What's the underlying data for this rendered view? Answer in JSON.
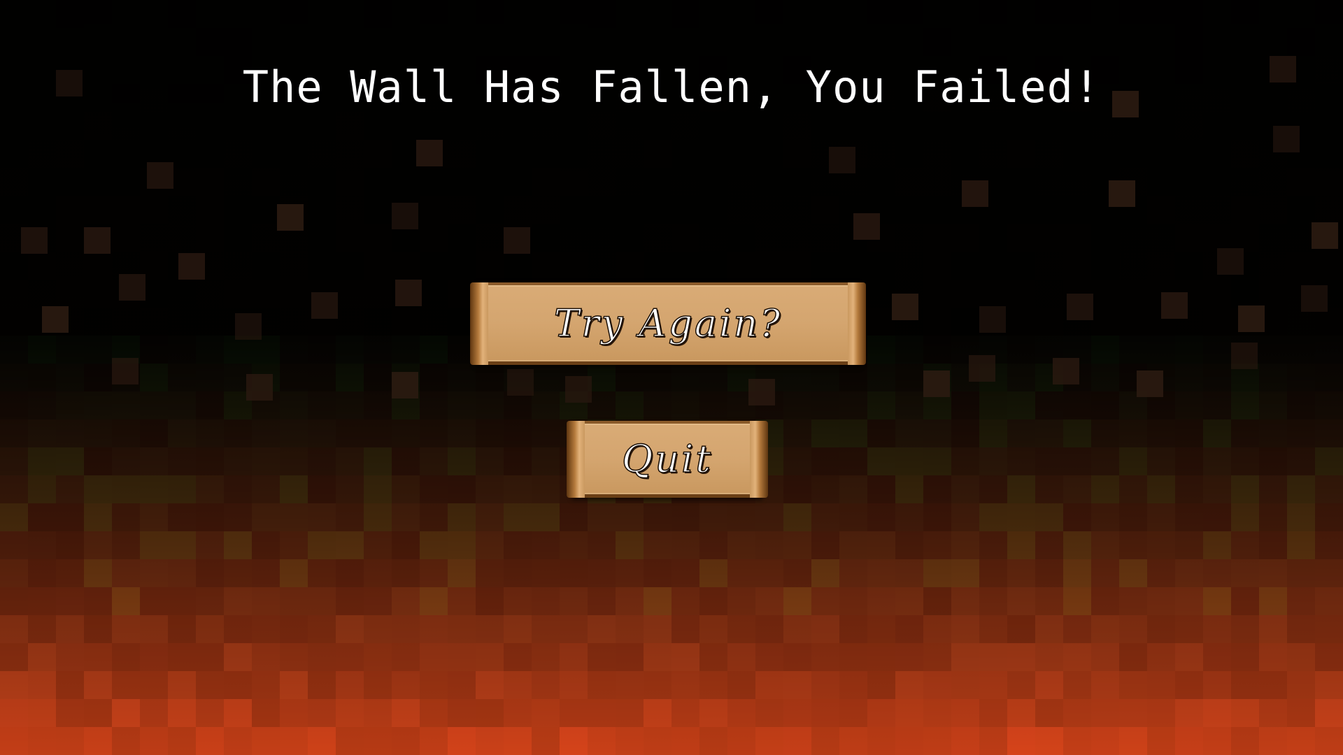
{
  "game_over": {
    "title": "The Wall Has Fallen, You Failed!",
    "buttons": {
      "try_again_label": "Try Again?",
      "quit_label": "Quit"
    }
  },
  "colors": {
    "background": "#060403",
    "ember": "#2b1a10",
    "scroll_parchment": "#d4a56f",
    "scroll_edge": "#6a3f16",
    "fire_red": "#a6281a",
    "fire_orange": "#b8471d",
    "text": "#ffffff"
  }
}
